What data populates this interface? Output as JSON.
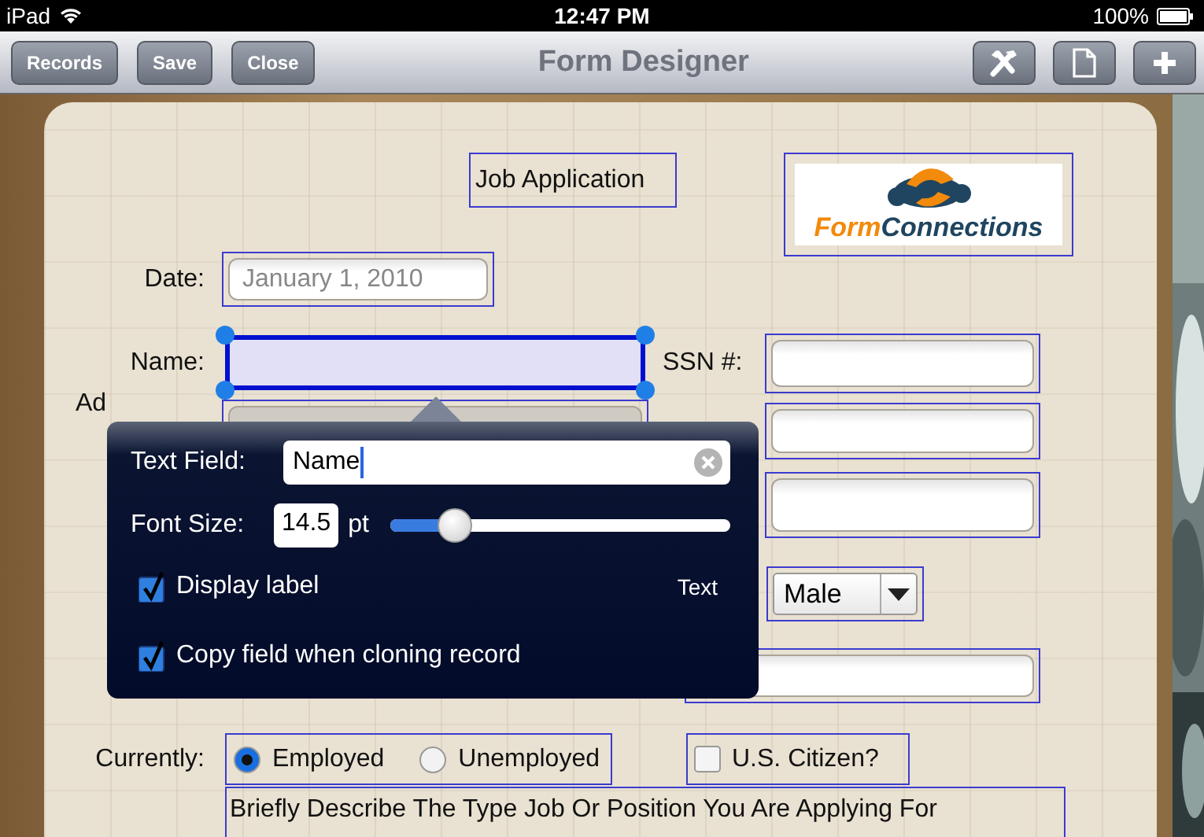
{
  "status_bar": {
    "device": "iPad",
    "time": "12:47 PM",
    "battery": "100%"
  },
  "toolbar": {
    "title": "Form Designer",
    "buttons": [
      "Records",
      "Save",
      "Close"
    ]
  },
  "form": {
    "title": "Job Application",
    "logo": [
      "Form",
      "Connections"
    ],
    "date": {
      "label": "Date:",
      "placeholder": "January 1, 2010"
    },
    "name": {
      "label": "Name:",
      "selected": true
    },
    "ssn": {
      "label": "SSN #:"
    },
    "address": {
      "label": "Ad"
    },
    "sex": {
      "value": "Male"
    },
    "currently": {
      "label": "Currently:",
      "options": [
        {
          "label": "Employed",
          "selected": true
        },
        {
          "label": "Unemployed",
          "selected": false
        }
      ]
    },
    "citizen": {
      "label": "U.S. Citizen?",
      "checked": false
    },
    "description": "Briefly Describe The Type Job Or Position You Are Applying For"
  },
  "popover": {
    "text_field_label": "Text Field:",
    "text_field_value": "Name",
    "font_size_label": "Font Size:",
    "font_size_value": "14.5",
    "unit": "pt",
    "slider": {
      "level": 0.19
    },
    "hint": "Text",
    "options": [
      {
        "label": "Display label",
        "checked": true
      },
      {
        "label": "Copy field when cloning record",
        "checked": true
      }
    ]
  }
}
